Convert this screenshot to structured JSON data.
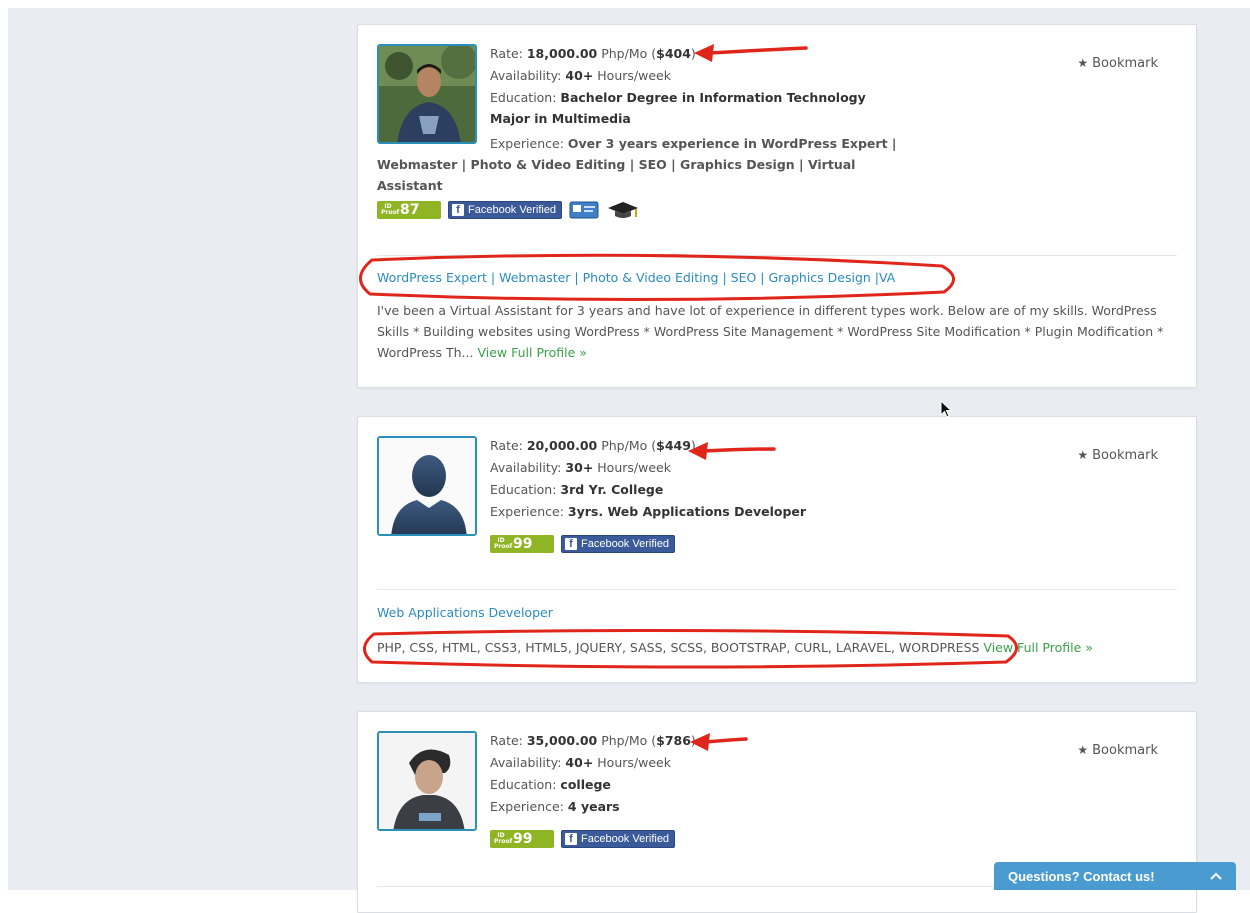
{
  "profiles": [
    {
      "rate_label": "Rate: ",
      "rate_value": "18,000.00",
      "rate_unit": " Php/Mo (",
      "rate_usd": "$404",
      "rate_close": ")",
      "availability_label": "Availability: ",
      "availability_value": "40+",
      "availability_unit": " Hours/week",
      "education_label": "Education: ",
      "education_value": "Bachelor Degree in Information Technology Major in Multimedia",
      "experience_label": "Experience: ",
      "experience_value": "Over 3 years experience in WordPress Expert | Webmaster | Photo & Video Editing | SEO | Graphics Design | Virtual Assistant",
      "id_proof_label": "ID Proof",
      "id_proof_score": "87",
      "facebook_label": "Facebook Verified",
      "bookmark_label": "Bookmark",
      "title": "WordPress Expert | Webmaster | Photo & Video Editing | SEO | Graphics Design |VA",
      "description": "I've been a Virtual Assistant for 3 years and have lot of experience in different types work. Below are of my skills. WordPress Skills * Building websites using WordPress * WordPress Site Management * WordPress Site Modification * Plugin Modification * WordPress Th... ",
      "view_profile": "View Full Profile »"
    },
    {
      "rate_label": "Rate: ",
      "rate_value": "20,000.00",
      "rate_unit": " Php/Mo (",
      "rate_usd": "$449",
      "rate_close": ")",
      "availability_label": "Availability: ",
      "availability_value": "30+",
      "availability_unit": " Hours/week",
      "education_label": "Education: ",
      "education_value": "3rd Yr. College",
      "experience_label": "Experience: ",
      "experience_value": "3yrs. Web Applications Developer",
      "id_proof_label": "ID Proof",
      "id_proof_score": "99",
      "facebook_label": "Facebook Verified",
      "bookmark_label": "Bookmark",
      "title": "Web Applications Developer",
      "description": "PHP, CSS, HTML, CSS3, HTML5, JQUERY, SASS, SCSS, BOOTSTRAP, CURL, LARAVEL, WORDPRESS ",
      "view_profile": "View Full Profile »"
    },
    {
      "rate_label": "Rate: ",
      "rate_value": "35,000.00",
      "rate_unit": " Php/Mo (",
      "rate_usd": "$786",
      "rate_close": ")",
      "availability_label": "Availability: ",
      "availability_value": "40+",
      "availability_unit": " Hours/week",
      "education_label": "Education: ",
      "education_value": "college",
      "experience_label": "Experience: ",
      "experience_value": "4 years",
      "id_proof_label": "ID Proof",
      "id_proof_score": "99",
      "facebook_label": "Facebook Verified",
      "bookmark_label": "Bookmark"
    }
  ],
  "contact_widget": {
    "label": "Questions? Contact us!",
    "icon": "chevron-up-icon"
  },
  "colors": {
    "link_blue": "#2a8bc1",
    "view_green": "#3aa14a",
    "annotation_red": "#e0261b",
    "facebook_blue": "#3a5a99",
    "idproof_green": "#8fb524",
    "contact_blue": "#4a9bd0"
  }
}
